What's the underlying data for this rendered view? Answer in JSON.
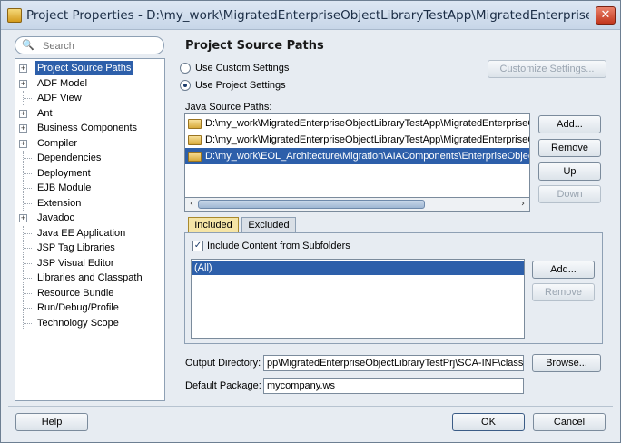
{
  "window": {
    "title": "Project Properties - D:\\my_work\\MigratedEnterpriseObjectLibraryTestApp\\MigratedEnterpriseObject..."
  },
  "search": {
    "placeholder": "Search"
  },
  "tree": {
    "items": [
      {
        "label": "Project Source Paths",
        "expandable": true,
        "selected": true
      },
      {
        "label": "ADF Model",
        "expandable": true,
        "selected": false
      },
      {
        "label": "ADF View",
        "expandable": false,
        "selected": false
      },
      {
        "label": "Ant",
        "expandable": true,
        "selected": false
      },
      {
        "label": "Business Components",
        "expandable": true,
        "selected": false
      },
      {
        "label": "Compiler",
        "expandable": true,
        "selected": false
      },
      {
        "label": "Dependencies",
        "expandable": false,
        "selected": false
      },
      {
        "label": "Deployment",
        "expandable": false,
        "selected": false
      },
      {
        "label": "EJB Module",
        "expandable": false,
        "selected": false
      },
      {
        "label": "Extension",
        "expandable": false,
        "selected": false
      },
      {
        "label": "Javadoc",
        "expandable": true,
        "selected": false
      },
      {
        "label": "Java EE Application",
        "expandable": false,
        "selected": false
      },
      {
        "label": "JSP Tag Libraries",
        "expandable": false,
        "selected": false
      },
      {
        "label": "JSP Visual Editor",
        "expandable": false,
        "selected": false
      },
      {
        "label": "Libraries and Classpath",
        "expandable": false,
        "selected": false
      },
      {
        "label": "Resource Bundle",
        "expandable": false,
        "selected": false
      },
      {
        "label": "Run/Debug/Profile",
        "expandable": false,
        "selected": false
      },
      {
        "label": "Technology Scope",
        "expandable": false,
        "selected": false
      }
    ]
  },
  "panel": {
    "title": "Project Source Paths",
    "radio_custom": "Use Custom Settings",
    "radio_project": "Use Project Settings",
    "customize_button": "Customize Settings...",
    "java_source_label": "Java Source Paths:",
    "source_paths": [
      "D:\\my_work\\MigratedEnterpriseObjectLibraryTestApp\\MigratedEnterpriseObj",
      "D:\\my_work\\MigratedEnterpriseObjectLibraryTestApp\\MigratedEnterpriseObj",
      "D:\\my_work\\EOL_Architecture\\Migration\\AIAComponents\\EnterpriseObjectLi"
    ],
    "path_buttons": {
      "add": "Add...",
      "remove": "Remove",
      "up": "Up",
      "down": "Down"
    },
    "tabs": {
      "included": "Included",
      "excluded": "Excluded"
    },
    "include_subfolders_label": "Include Content from Subfolders",
    "included_items": [
      "(All)"
    ],
    "include_buttons": {
      "add": "Add...",
      "remove": "Remove"
    },
    "output_dir_label": "Output Directory:",
    "output_dir_value": "pp\\MigratedEnterpriseObjectLibraryTestPrj\\SCA-INF\\classes",
    "browse_button": "Browse...",
    "default_package_label": "Default Package:",
    "default_package_value": "mycompany.ws"
  },
  "footer": {
    "help": "Help",
    "ok": "OK",
    "cancel": "Cancel"
  }
}
